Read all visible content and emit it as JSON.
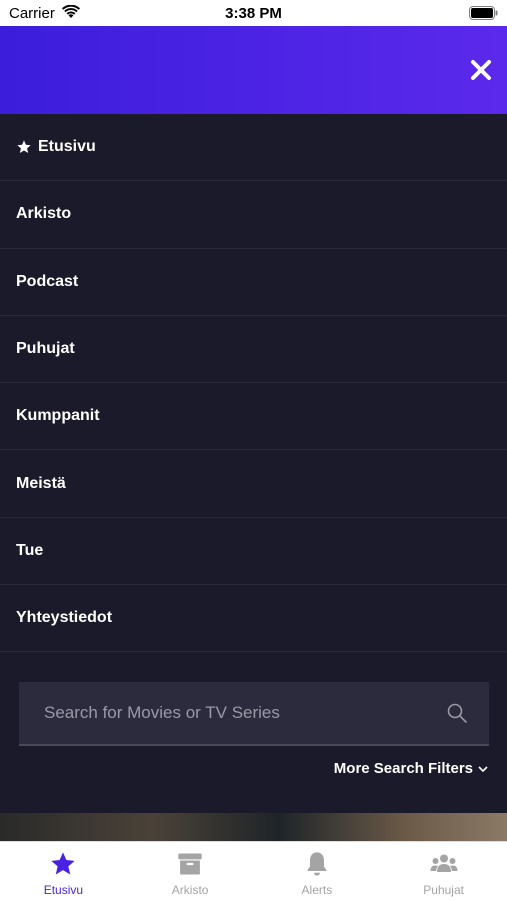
{
  "status_bar": {
    "carrier": "Carrier",
    "time": "3:38 PM"
  },
  "menu": {
    "items": [
      {
        "label": "Etusivu",
        "icon": "star-icon"
      },
      {
        "label": "Arkisto"
      },
      {
        "label": "Podcast"
      },
      {
        "label": "Puhujat"
      },
      {
        "label": "Kumppanit"
      },
      {
        "label": "Meistä"
      },
      {
        "label": "Tue"
      },
      {
        "label": "Yhteystiedot"
      }
    ]
  },
  "search": {
    "placeholder": "Search for Movies or TV Series",
    "more_filters": "More Search Filters"
  },
  "tabs": [
    {
      "label": "Etusivu",
      "icon": "star-icon",
      "active": true
    },
    {
      "label": "Arkisto",
      "icon": "archive-icon"
    },
    {
      "label": "Alerts",
      "icon": "bell-icon"
    },
    {
      "label": "Puhujat",
      "icon": "users-icon"
    }
  ],
  "colors": {
    "accent": "#4a22e4",
    "header_start": "#3c1ddc",
    "header_end": "#5b29ec",
    "background": "#1b1a2b",
    "inactive_tab": "#a4a4a4"
  }
}
